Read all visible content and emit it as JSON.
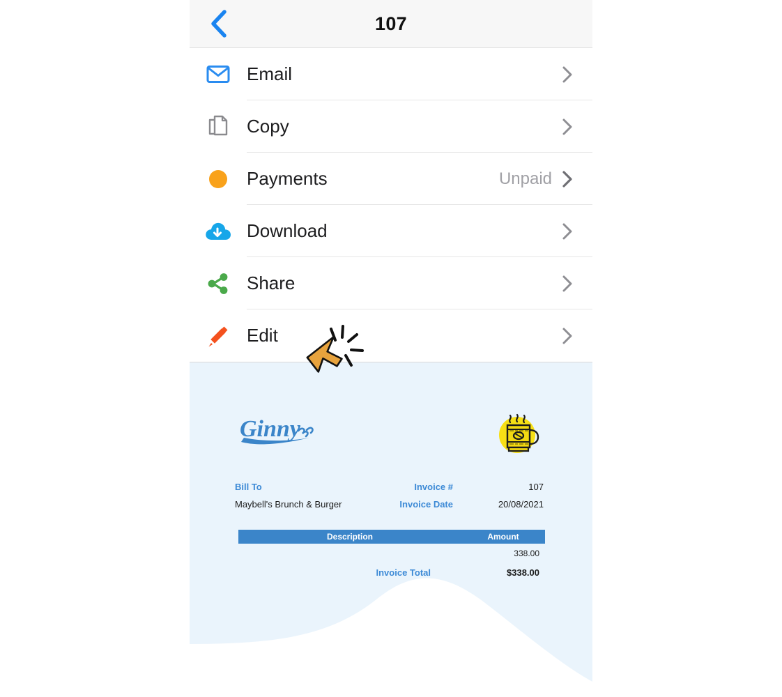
{
  "header": {
    "title": "107",
    "back_icon": "chevron-left-icon",
    "back_color": "#1a84f0"
  },
  "menu": {
    "items": [
      {
        "label": "Email",
        "icon": "envelope-icon",
        "icon_color": "#2a8cf0",
        "status": "",
        "chevron": "chevron-right-icon"
      },
      {
        "label": "Copy",
        "icon": "copy-icon",
        "icon_color": "#8a8a8e",
        "status": "",
        "chevron": "chevron-right-icon"
      },
      {
        "label": "Payments",
        "icon": "status-dot-icon",
        "icon_color": "#f9a21b",
        "status": "Unpaid",
        "chevron": "chevron-right-icon"
      },
      {
        "label": "Download",
        "icon": "cloud-download-icon",
        "icon_color": "#16a6e9",
        "status": "",
        "chevron": "chevron-right-icon"
      },
      {
        "label": "Share",
        "icon": "share-nodes-icon",
        "icon_color": "#4aa94a",
        "status": "",
        "chevron": "chevron-right-icon"
      },
      {
        "label": "Edit",
        "icon": "pencil-icon",
        "icon_color": "#f4511e",
        "status": "",
        "chevron": "chevron-right-icon"
      }
    ]
  },
  "invoice": {
    "brand_name": "Ginny",
    "brand_color": "#3b85c9",
    "logo_mark": "coffee-cup-icon",
    "bill_to_label": "Bill To",
    "bill_to_name": "Maybell's Brunch & Burger",
    "meta": [
      {
        "label": "Invoice #",
        "value": "107"
      },
      {
        "label": "Invoice Date",
        "value": "20/08/2021"
      }
    ],
    "table": {
      "columns": [
        "Description",
        "Amount"
      ],
      "rows": [
        {
          "description": "",
          "amount": "338.00"
        }
      ],
      "total_label": "Invoice Total",
      "total_value": "$338.00"
    },
    "accent_color": "#3b85c9",
    "background_color": "#eaf4fc"
  },
  "cursor": {
    "type": "click-cursor",
    "fill": "#e8a33d"
  }
}
